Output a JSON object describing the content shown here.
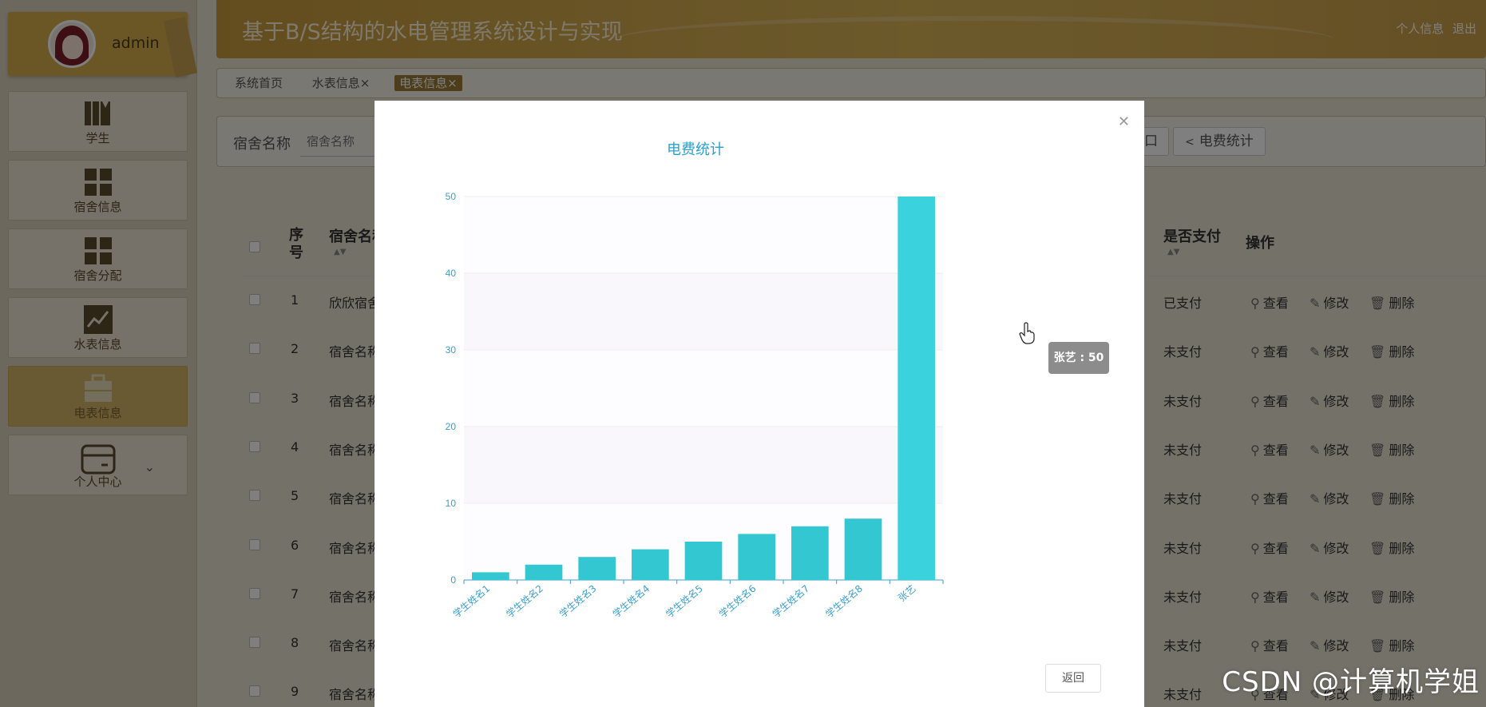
{
  "sidebar": {
    "user": "admin",
    "items": [
      {
        "label": "学生",
        "icon": "books-icon"
      },
      {
        "label": "宿舍信息",
        "icon": "grid-icon"
      },
      {
        "label": "宿舍分配",
        "icon": "grid-icon"
      },
      {
        "label": "水表信息",
        "icon": "trend-chart-icon"
      },
      {
        "label": "电表信息",
        "icon": "briefcase-icon"
      },
      {
        "label": "个人中心",
        "icon": "wallet-icon"
      }
    ]
  },
  "header": {
    "title": "基于B/S结构的水电管理系统设计与实现",
    "profile_link": "个人信息",
    "logout_link": "退出"
  },
  "tabs": [
    {
      "label": "系统首页"
    },
    {
      "label": "水表信息×"
    },
    {
      "label": "电表信息×"
    }
  ],
  "search": {
    "label": "宿舍名称",
    "placeholder": "宿舍名称",
    "button_partial": "口",
    "stats_button": "电费统计"
  },
  "table": {
    "headers": {
      "index_line1": "序",
      "index_line2": "号",
      "dorm_name": "宿舍名称",
      "paid": "是否支付",
      "actions": "操作"
    },
    "action_labels": {
      "view": "查看",
      "edit": "修改",
      "delete": "删除"
    },
    "rows": [
      {
        "index": "1",
        "dorm": "欣欣宿舍",
        "paid": "已支付"
      },
      {
        "index": "2",
        "dorm": "宿舍名称",
        "paid": "未支付"
      },
      {
        "index": "3",
        "dorm": "宿舍名称",
        "paid": "未支付"
      },
      {
        "index": "4",
        "dorm": "宿舍名称",
        "paid": "未支付"
      },
      {
        "index": "5",
        "dorm": "宿舍名称",
        "paid": "未支付"
      },
      {
        "index": "6",
        "dorm": "宿舍名称",
        "paid": "未支付"
      },
      {
        "index": "7",
        "dorm": "宿舍名称",
        "paid": "未支付"
      },
      {
        "index": "8",
        "dorm": "宿舍名称",
        "paid": "未支付"
      },
      {
        "index": "9",
        "dorm": "宿舍名称",
        "paid": "未支付"
      }
    ]
  },
  "modal": {
    "back_label": "返回",
    "tooltip": "张艺 : 50"
  },
  "chart_data": {
    "type": "bar",
    "title": "电费统计",
    "categories": [
      "学生姓名1",
      "学生姓名2",
      "学生姓名3",
      "学生姓名4",
      "学生姓名5",
      "学生姓名6",
      "学生姓名7",
      "学生姓名8",
      "张艺"
    ],
    "values": [
      1,
      2,
      3,
      4,
      5,
      6,
      7,
      8,
      50
    ],
    "ylim": [
      0,
      50
    ],
    "yticks": [
      0,
      10,
      20,
      30,
      40,
      50
    ],
    "bar_color": "#33c7d1",
    "highlight_color": "#3ad2dc",
    "axis_color": "#3a9fd0",
    "title_color": "#2aa0d0"
  },
  "watermark": "CSDN @计算机学姐"
}
